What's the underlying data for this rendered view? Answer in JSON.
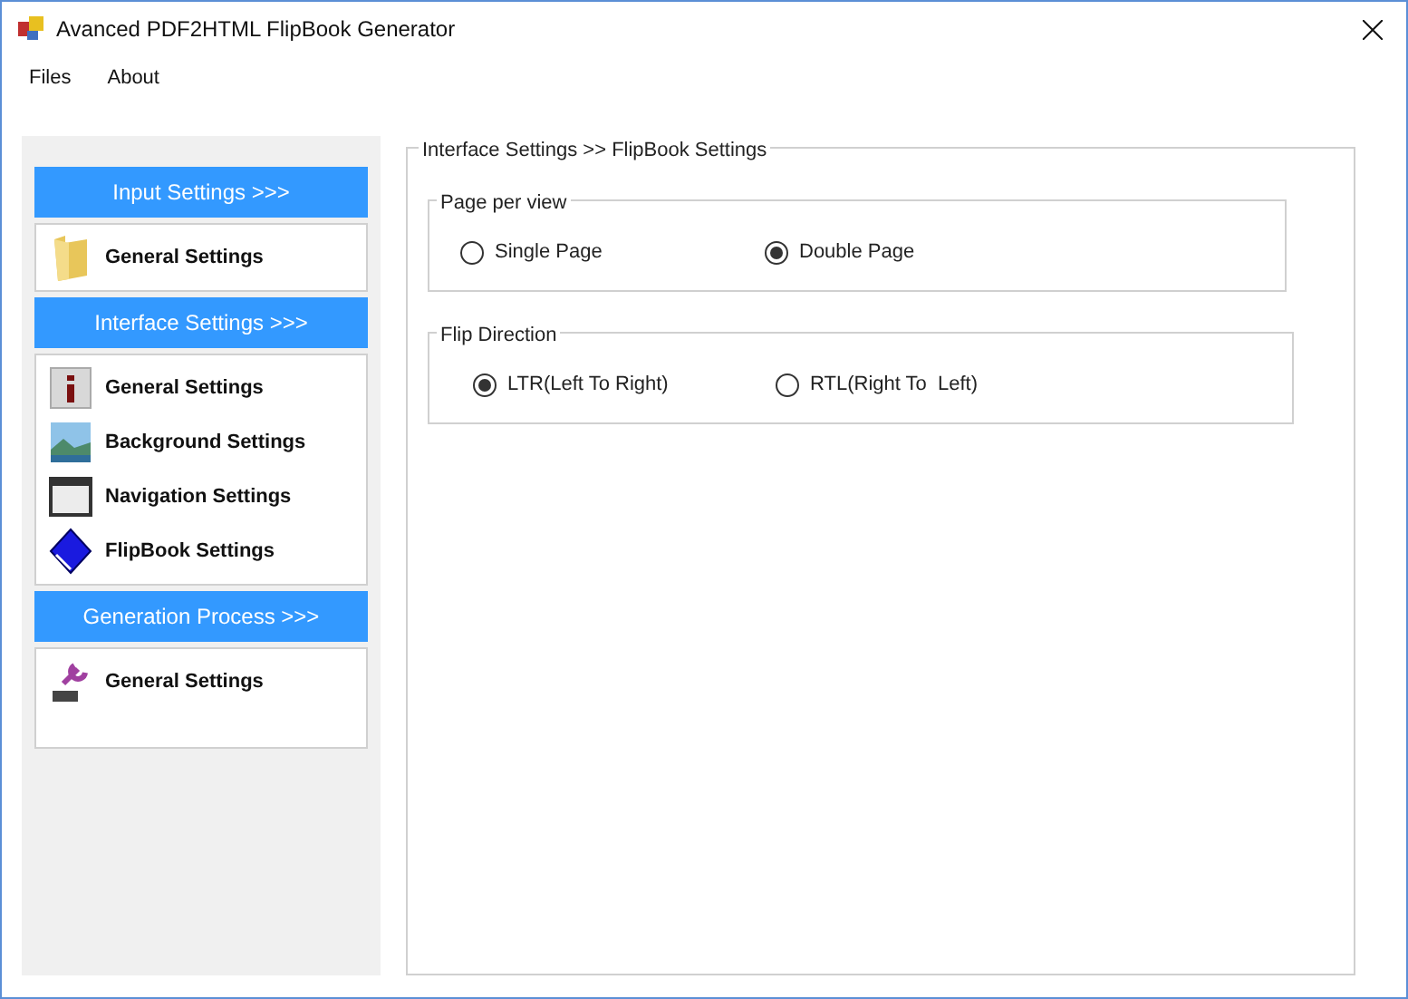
{
  "window": {
    "title": "Avanced PDF2HTML FlipBook Generator"
  },
  "menu": [
    {
      "label": "Files"
    },
    {
      "label": "About"
    }
  ],
  "sidebar": [
    {
      "header": "Input Settings >>>",
      "items": [
        {
          "label": "General Settings",
          "kind": "folder",
          "selected": false
        }
      ]
    },
    {
      "header": "Interface Settings >>>",
      "items": [
        {
          "label": "General Settings",
          "kind": "info",
          "selected": false
        },
        {
          "label": "Background Settings",
          "kind": "landscape",
          "selected": false
        },
        {
          "label": "Navigation Settings",
          "kind": "window",
          "selected": false
        },
        {
          "label": "FlipBook Settings",
          "kind": "book",
          "selected": false
        }
      ]
    },
    {
      "header": "Generation Process >>>",
      "items": [
        {
          "label": "General Settings",
          "kind": "wrench",
          "selected": false
        }
      ]
    }
  ],
  "panel": {
    "title": "Interface Settings >> FlipBook Settings",
    "groups": [
      {
        "title": "Page per view",
        "options": [
          {
            "label": "Single Page",
            "selected": false
          },
          {
            "label": "Double Page",
            "selected": true
          }
        ]
      },
      {
        "title": "Flip Direction",
        "options": [
          {
            "label": "LTR(Left To Right)",
            "selected": true
          },
          {
            "label": "RTL(Right To  Left)",
            "selected": false
          }
        ]
      }
    ]
  }
}
